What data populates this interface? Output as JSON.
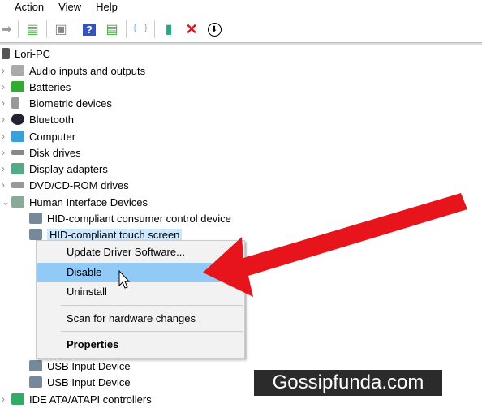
{
  "menubar": {
    "items": [
      "Action",
      "View",
      "Help"
    ]
  },
  "toolbar": {
    "icons": [
      "forward-arrow-icon",
      "show-hide-console-icon",
      "properties-icon",
      "help-icon",
      "action-pane-icon",
      "scan-hardware-icon",
      "update-driver-icon",
      "uninstall-x-icon",
      "disable-down-arrow-icon"
    ]
  },
  "tree": {
    "root": "Lori-PC",
    "categories": [
      "Audio inputs and outputs",
      "Batteries",
      "Biometric devices",
      "Bluetooth",
      "Computer",
      "Disk drives",
      "Display adapters",
      "DVD/CD-ROM drives",
      "Human Interface Devices"
    ],
    "hid_children": [
      "HID-compliant consumer control device",
      "HID-compliant touch screen"
    ],
    "hid_children_bottom": [
      "USB Input Device",
      "USB Input Device"
    ],
    "after": "IDE ATA/ATAPI controllers"
  },
  "context_menu": {
    "items": [
      "Update Driver Software...",
      "Disable",
      "Uninstall",
      "Scan for hardware changes",
      "Properties"
    ],
    "highlighted": "Disable"
  },
  "watermark": "Gossipfunda.com",
  "colors": {
    "arrow": "#e8141c",
    "highlight": "#91c9f7",
    "selection": "#cce8ff"
  }
}
